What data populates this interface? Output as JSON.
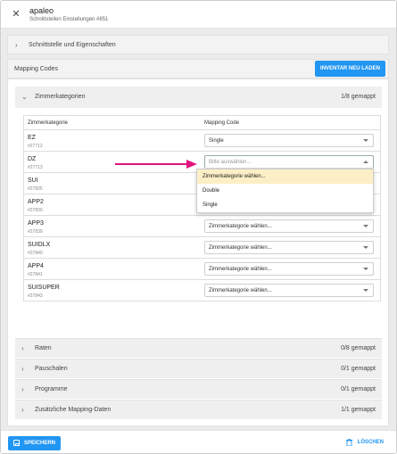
{
  "header": {
    "title": "apaleo",
    "subtitle": "Schnittstellen Einstellungen #851"
  },
  "section_interface": {
    "label": "Schnittstelle und Eigenschaften"
  },
  "mapping": {
    "label": "Mapping Codes",
    "inventory_button": "INVENTAR NEU LADEN"
  },
  "zimmerkategorien": {
    "label": "Zimmerkategorien",
    "count": "1/8 gemappt",
    "col_category": "Zimmerkategorie",
    "col_mapping": "Mapping Code",
    "rows": [
      {
        "code": "EZ",
        "id": "#27712",
        "value": "Single"
      },
      {
        "code": "DZ",
        "id": "#27713",
        "value": "Bitte auswählen..."
      },
      {
        "code": "SUI",
        "id": "#27825",
        "value": ""
      },
      {
        "code": "APP2",
        "id": "#27830",
        "value": ""
      },
      {
        "code": "APP3",
        "id": "#27839",
        "value": "Zimmerkategorie wählen..."
      },
      {
        "code": "SUIDLX",
        "id": "#27840",
        "value": "Zimmerkategorie wählen..."
      },
      {
        "code": "APP4",
        "id": "#27841",
        "value": "Zimmerkategorie wählen..."
      },
      {
        "code": "SUISUPER",
        "id": "#27843",
        "value": "Zimmerkategorie wählen..."
      }
    ],
    "dropdown_options": [
      "Zimmerkategorie wählen...",
      "Double",
      "Single"
    ]
  },
  "collapsed_sections": [
    {
      "label": "Raten",
      "count": "0/8 gemappt"
    },
    {
      "label": "Pauschalen",
      "count": "0/1 gemappt"
    },
    {
      "label": "Programme",
      "count": "0/1 gemappt"
    },
    {
      "label": "Zusätzliche Mapping-Daten",
      "count": "1/1 gemappt"
    }
  ],
  "footer": {
    "save": "SPEICHERN",
    "delete": "LÖSCHEN"
  },
  "colors": {
    "accent": "#2196f3",
    "arrow": "#e0157d",
    "highlight": "#fcefc6"
  }
}
